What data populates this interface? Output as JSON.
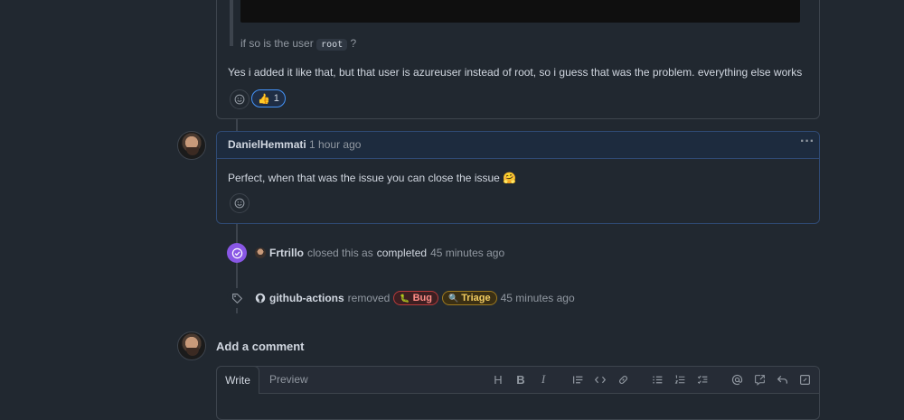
{
  "quote": {
    "text_before": "if so is the user",
    "code": "root",
    "text_after": "?"
  },
  "comment1": {
    "body": "Yes i added it like that, but that user is azureuser instead of root, so i guess that was the problem. everything else works",
    "reaction_emoji": "👍",
    "reaction_count": "1"
  },
  "comment2": {
    "author": "DanielHemmati",
    "time": "1 hour ago",
    "body": "Perfect, when that was the issue you can close the issue 🤗",
    "menu_icon": "···"
  },
  "event_closed": {
    "actor": "Frtrillo",
    "text": "closed this as",
    "state": "completed",
    "time": "45 minutes ago"
  },
  "event_labels": {
    "actor": "github-actions",
    "text": "removed",
    "labels": [
      {
        "icon": "🐛",
        "name": "Bug",
        "color": "#f85149"
      },
      {
        "icon": "🔍",
        "name": "Triage",
        "color": "#d29922"
      }
    ],
    "time": "45 minutes ago"
  },
  "add_comment": {
    "title": "Add a comment",
    "tab_write": "Write",
    "tab_preview": "Preview"
  },
  "toolbar": {
    "heading": "H",
    "bold": "B",
    "italic": "I"
  },
  "colors": {
    "background": "#212830",
    "border": "#3d444d",
    "accent_blue": "#4493f8",
    "done_purple": "#8957e5"
  }
}
